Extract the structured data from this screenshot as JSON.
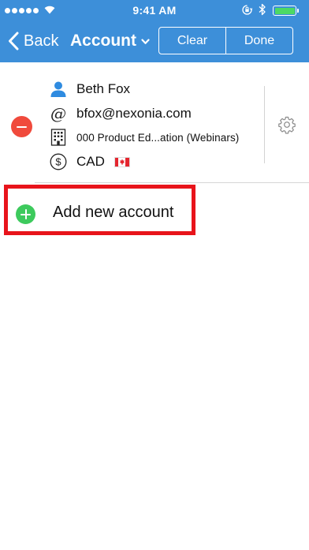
{
  "status_bar": {
    "time": "9:41 AM",
    "signal_dots": 5,
    "battery_level": 1.0,
    "icons": [
      "signal-icon",
      "wifi-icon",
      "rotation-lock-icon",
      "bluetooth-icon",
      "battery-icon"
    ]
  },
  "nav": {
    "back_label": "Back",
    "title": "Account",
    "clear_label": "Clear",
    "done_label": "Done"
  },
  "account": {
    "name": "Beth Fox",
    "email": "bfox@nexonia.com",
    "department": "000 Product Ed...ation (Webinars)",
    "currency": "CAD",
    "icons": {
      "name": "person-icon",
      "email": "at-icon",
      "department": "building-icon",
      "currency": "dollar-icon",
      "flag": "canada-flag-icon",
      "settings": "gear-icon",
      "delete": "minus-circle-icon"
    }
  },
  "add_account": {
    "label": "Add new account",
    "icon": "plus-circle-icon"
  },
  "colors": {
    "header_blue": "#3d8fd9",
    "delete_red": "#f04a3c",
    "add_green": "#3dca5d",
    "highlight_red": "#e8141b",
    "battery_green": "#4cd964"
  }
}
